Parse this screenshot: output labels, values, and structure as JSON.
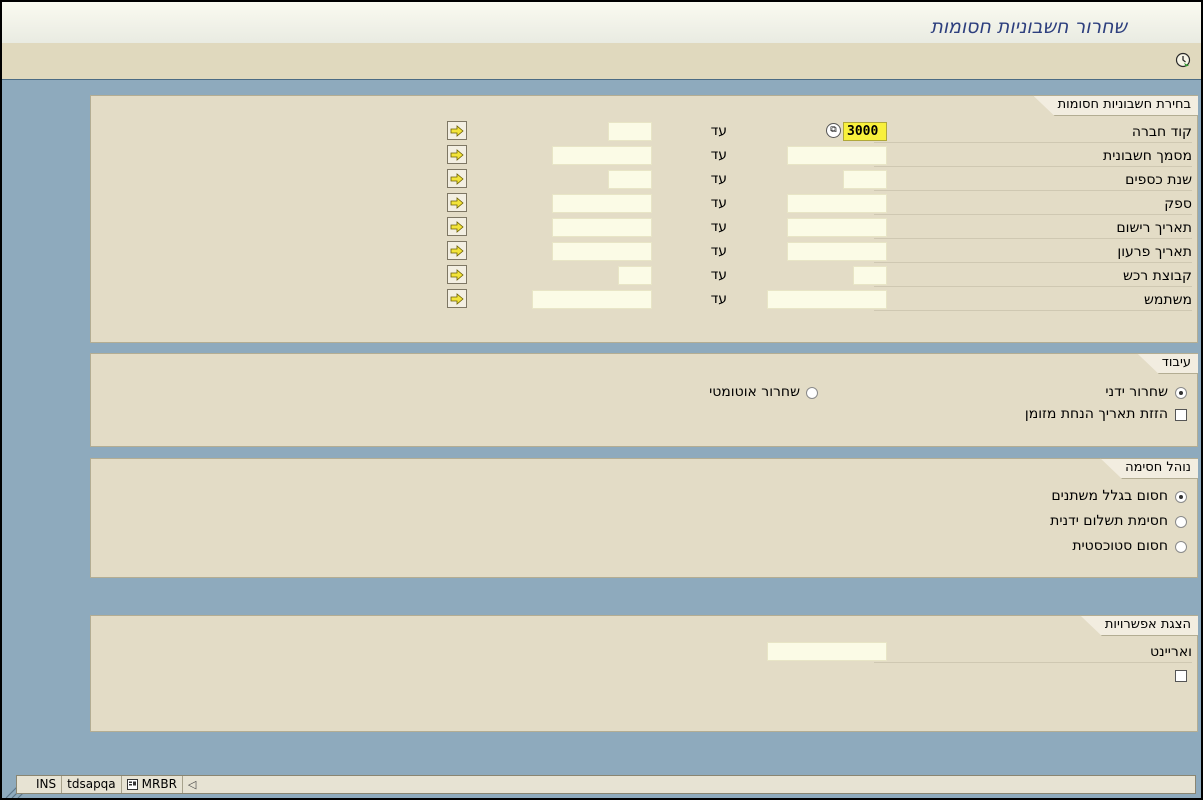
{
  "window": {
    "title": "שחרור חשבוניות חסומות"
  },
  "toolbar": {
    "execute_icon": "execute-clock-icon"
  },
  "selection_panel": {
    "title": "בחירת חשבוניות חסומות",
    "to_label": "עד",
    "rows": [
      {
        "label": "קוד חברה",
        "from_value": "3000",
        "to_value": ""
      },
      {
        "label": "מסמך חשבונית",
        "from_value": "",
        "to_value": ""
      },
      {
        "label": "שנת כספים",
        "from_value": "",
        "to_value": ""
      },
      {
        "label": "ספק",
        "from_value": "",
        "to_value": ""
      },
      {
        "label": "תאריך רישום",
        "from_value": "",
        "to_value": ""
      },
      {
        "label": "תאריך פרעון",
        "from_value": "",
        "to_value": ""
      },
      {
        "label": "קבוצת רכש",
        "from_value": "",
        "to_value": ""
      },
      {
        "label": "משתמש",
        "from_value": "",
        "to_value": ""
      }
    ]
  },
  "processing_panel": {
    "title": "עיבוד",
    "manual_release": "שחרור ידני",
    "auto_release": "שחרור אוטומטי",
    "shift_baseline": "הזזת תאריך הנחת מזומן",
    "manual_selected": true
  },
  "blocking_panel": {
    "title": "נוהל חסימה",
    "options": [
      "חסום בגלל משתנים",
      "חסימת תשלום ידנית",
      "חסום סטוכסטית"
    ],
    "selected_index": 0
  },
  "display_panel": {
    "title": "הצגת אפשרויות",
    "variant_label": "ואריינט",
    "variant_value": ""
  },
  "status_bar": {
    "mode": "INS",
    "server": "tdsapqa",
    "transaction": "MRBR"
  },
  "colors": {
    "background": "#8eaabd",
    "panel": "#e3dcc6",
    "input": "#fbfbe6",
    "active_input": "#f8f03c",
    "title_text": "#2d3f7e"
  }
}
